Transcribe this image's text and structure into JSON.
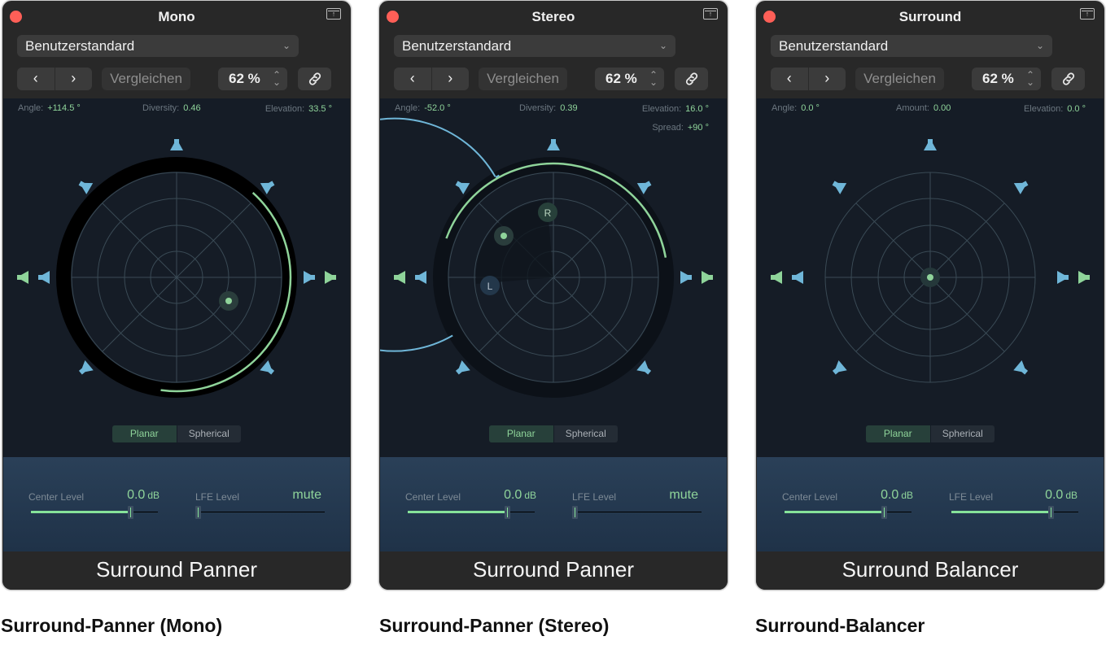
{
  "panels": [
    {
      "title": "Mono",
      "preset": "Benutzerstandard",
      "nav_prev": "‹",
      "nav_next": "›",
      "compare_label": "Vergleichen",
      "zoom_value": "62 %",
      "params": [
        {
          "label": "Angle:",
          "value": "+114.5 °"
        },
        {
          "label": "Diversity:",
          "value": "0.46"
        },
        {
          "label": "Elevation:",
          "value": "33.5 °"
        }
      ],
      "mode_options": [
        "Planar",
        "Spherical"
      ],
      "mode_selected": "Planar",
      "center_level": {
        "label": "Center Level",
        "value": "0.0",
        "unit": "dB",
        "fill_fraction": 0.78
      },
      "lfe_level": {
        "label": "LFE Level",
        "value": "mute",
        "unit": "",
        "fill_fraction": 0.0
      },
      "plugin_name": "Surround Panner",
      "caption": "Surround-Panner (Mono)"
    },
    {
      "title": "Stereo",
      "preset": "Benutzerstandard",
      "nav_prev": "‹",
      "nav_next": "›",
      "compare_label": "Vergleichen",
      "zoom_value": "62 %",
      "params": [
        {
          "label": "Angle:",
          "value": "-52.0 °"
        },
        {
          "label": "Diversity:",
          "value": "0.39"
        },
        {
          "label": "Elevation:",
          "value": "16.0 °"
        },
        {
          "label": "Spread:",
          "value": "+90 °"
        }
      ],
      "channel_labels": [
        "L",
        "R"
      ],
      "mode_options": [
        "Planar",
        "Spherical"
      ],
      "mode_selected": "Planar",
      "center_level": {
        "label": "Center Level",
        "value": "0.0",
        "unit": "dB",
        "fill_fraction": 0.78
      },
      "lfe_level": {
        "label": "LFE Level",
        "value": "mute",
        "unit": "",
        "fill_fraction": 0.0
      },
      "plugin_name": "Surround Panner",
      "caption": "Surround-Panner (Stereo)"
    },
    {
      "title": "Surround",
      "preset": "Benutzerstandard",
      "nav_prev": "‹",
      "nav_next": "›",
      "compare_label": "Vergleichen",
      "zoom_value": "62 %",
      "params": [
        {
          "label": "Angle:",
          "value": "0.0 °"
        },
        {
          "label": "Amount:",
          "value": "0.00"
        },
        {
          "label": "Elevation:",
          "value": "0.0 °"
        }
      ],
      "mode_options": [
        "Planar",
        "Spherical"
      ],
      "mode_selected": "Planar",
      "center_level": {
        "label": "Center Level",
        "value": "0.0",
        "unit": "dB",
        "fill_fraction": 0.78
      },
      "lfe_level": {
        "label": "LFE Level",
        "value": "0.0",
        "unit": "dB",
        "fill_fraction": 0.78
      },
      "plugin_name": "Surround Balancer",
      "caption": "Surround-Balancer"
    }
  ],
  "icons": {
    "close": "close-icon",
    "expand": "expand-icon",
    "expand_glyph": "↑",
    "dropdown": "⌄",
    "stepper": "⌃⌄",
    "link": "link-icon",
    "speaker": "speaker-icon"
  },
  "colors": {
    "accent_green": "#8fd49a",
    "speaker_blue": "#6fb6d8",
    "close_red": "#fe5f57"
  }
}
